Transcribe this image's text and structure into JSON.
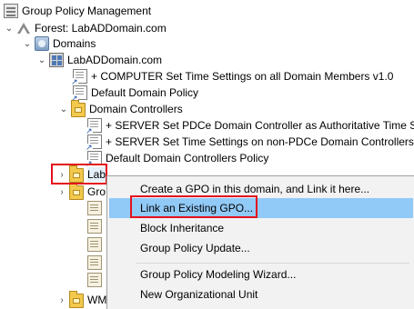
{
  "tree": {
    "root_label": "Group Policy Management",
    "forest_label": "Forest: LabADDomain.com",
    "domains_label": "Domains",
    "domain_label": "LabADDomain.com",
    "gpo_computer_time": "+ COMPUTER Set Time Settings on all Domain Members v1.0",
    "gpo_default_domain": "Default Domain Policy",
    "domain_controllers_label": "Domain Controllers",
    "gpo_server_pdce": "+ SERVER Set PDCe Domain Controller as Authoritative Time Ser",
    "gpo_server_nonpdce": "+ SERVER Set Time Settings on non-PDCe Domain Controllers v",
    "gpo_default_dc": "Default Domain Controllers Policy",
    "lab_label": "Lab",
    "group_policy_objects_partial": "Gro",
    "wmi_partial": "WM"
  },
  "context_menu": {
    "items": [
      "Create a GPO in this domain, and Link it here...",
      "Link an Existing GPO...",
      "Block Inheritance",
      "Group Policy Update...",
      "Group Policy Modeling Wizard...",
      "New Organizational Unit"
    ],
    "hovered_item": "Link an Existing GPO..."
  },
  "colors": {
    "highlight_border": "#e3111d",
    "menu_hover": "#91c9f7",
    "menu_background": "#f2f2f2"
  }
}
